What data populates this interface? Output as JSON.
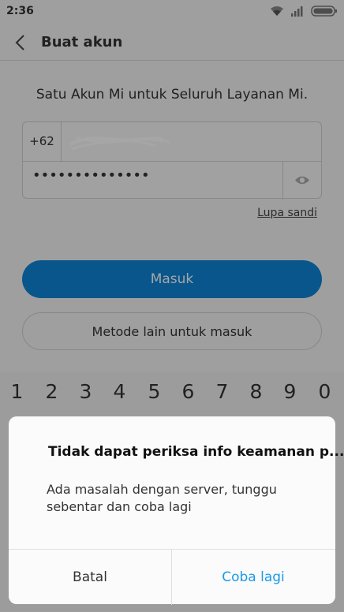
{
  "status_bar": {
    "time": "2:36"
  },
  "header": {
    "title": "Buat akun"
  },
  "form": {
    "subtitle": "Satu Akun Mi untuk Seluruh Layanan Mi.",
    "country_code": "+62",
    "password_value": "••••••••••••••",
    "forgot_link": "Lupa sandi"
  },
  "buttons": {
    "login": "Masuk",
    "other_methods": "Metode lain untuk masuk"
  },
  "keyboard": {
    "number_keys": [
      "1",
      "2",
      "3",
      "4",
      "5",
      "6",
      "7",
      "8",
      "9",
      "0"
    ]
  },
  "dialog": {
    "title": "Tidak dapat periksa info keamanan p...",
    "message": "Ada masalah dengan server, tunggu sebentar dan coba lagi",
    "cancel_label": "Batal",
    "retry_label": "Coba lagi"
  },
  "colors": {
    "primary": "#0d84d8",
    "link": "#1a9ae6"
  }
}
